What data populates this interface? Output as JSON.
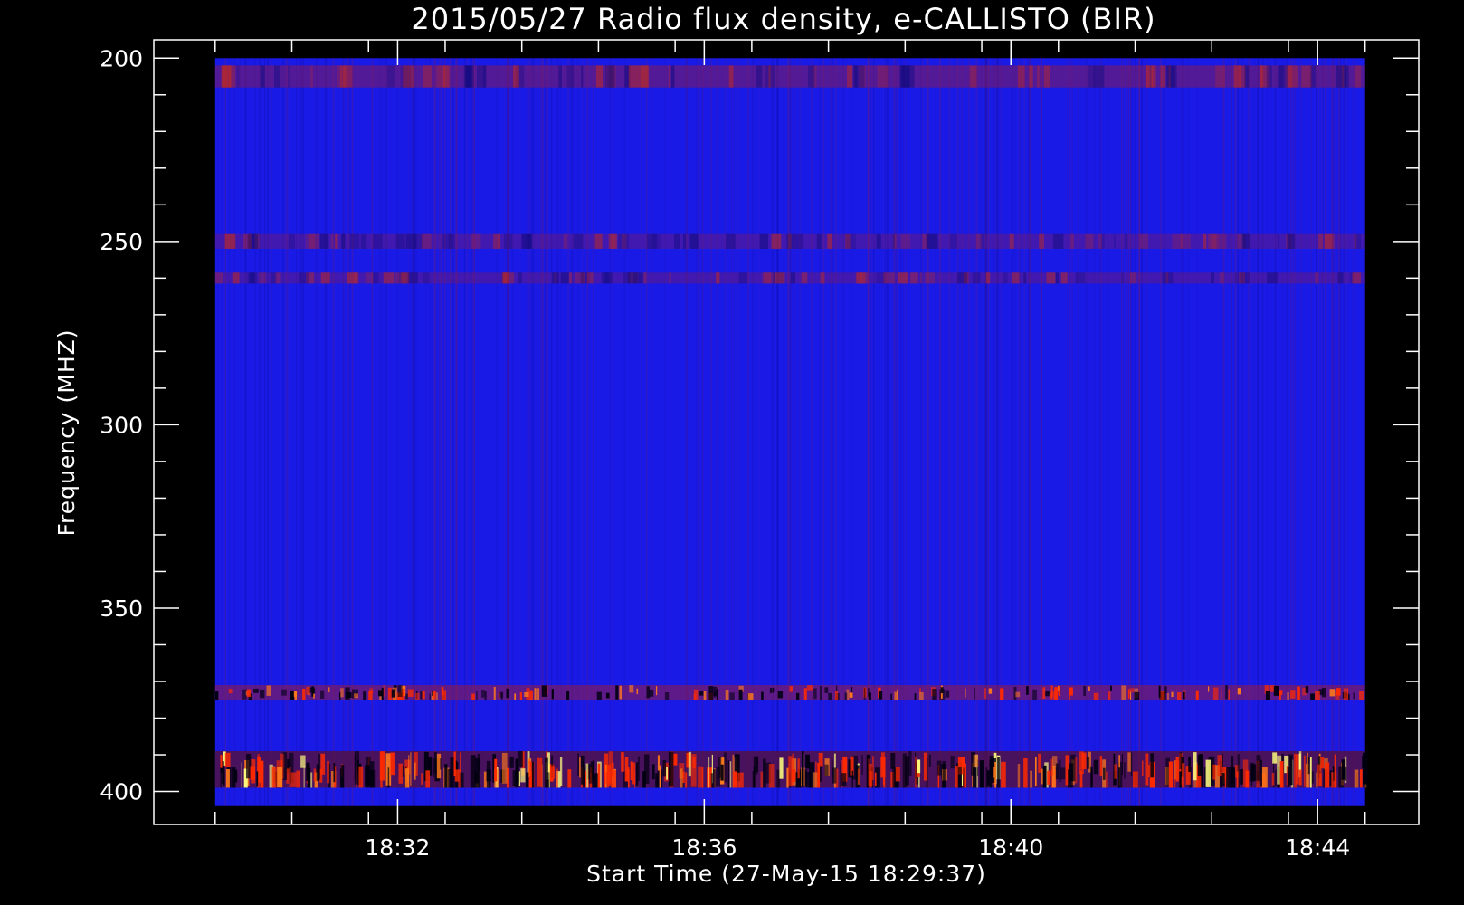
{
  "chart_data": {
    "type": "heatmap",
    "title": "2015/05/27  Radio flux density, e-CALLISTO (BIR)",
    "xlabel": "Start Time (27-May-15 18:29:37)",
    "ylabel": "Frequency (MHZ)",
    "x_ticks": [
      {
        "value": "18:32",
        "minutes": 2.38
      },
      {
        "value": "18:36",
        "minutes": 6.38
      },
      {
        "value": "18:40",
        "minutes": 10.38
      },
      {
        "value": "18:44",
        "minutes": 14.38
      }
    ],
    "y_ticks": [
      200,
      250,
      300,
      350,
      400
    ],
    "x_range_minutes": [
      -0.8,
      15.7
    ],
    "ylim": [
      195,
      409
    ],
    "data_extent": {
      "t_start_minutes": 0,
      "t_end_minutes": 15.0,
      "f_top": 200,
      "f_bottom": 404
    },
    "colors": {
      "background": "#000000",
      "low": "#1a1ae6",
      "mid": "#8b1a4a",
      "high": "#ff2a00",
      "peak": "#ffff80",
      "axis": "#ffffff"
    },
    "features": [
      {
        "name": "narrow band",
        "f_center": 373,
        "f_width": 4,
        "intensity": "high"
      },
      {
        "name": "broad band",
        "f_center": 394,
        "f_width": 10,
        "intensity": "very high"
      },
      {
        "name": "faint band",
        "f_center": 205,
        "f_width": 6,
        "intensity": "medium"
      },
      {
        "name": "faint band",
        "f_center": 250,
        "f_width": 4,
        "intensity": "low"
      },
      {
        "name": "faint band",
        "f_center": 260,
        "f_width": 3,
        "intensity": "low"
      }
    ]
  }
}
